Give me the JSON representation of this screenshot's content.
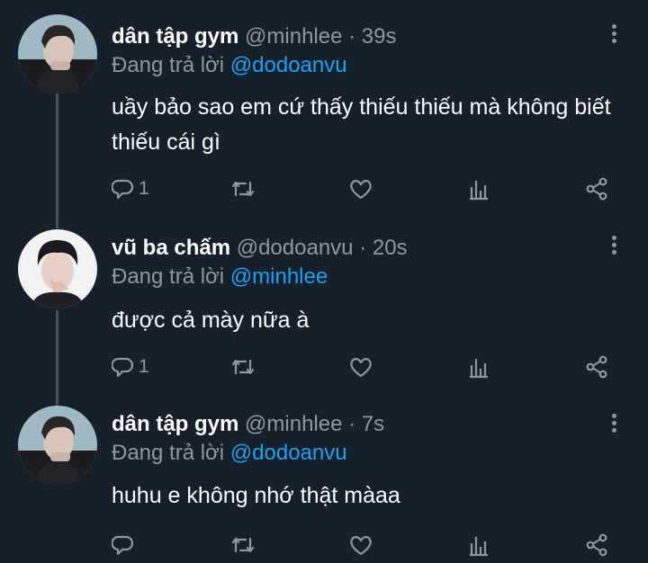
{
  "tweets": [
    {
      "name": "dân tập gym",
      "handle": "@minhlee",
      "dot": "·",
      "time": "39s",
      "reply_prefix": "Đang trả lời",
      "reply_to": "@dodoanvu",
      "text": "uầy bảo sao em cứ thấy thiếu thiếu mà không biết  thiếu cái gì",
      "reply_count": "1"
    },
    {
      "name": "vũ ba chấm",
      "handle": "@dodoanvu",
      "dot": "·",
      "time": "20s",
      "reply_prefix": "Đang trả lời",
      "reply_to": "@minhlee",
      "text": "được cả mày nữa à",
      "reply_count": "1"
    },
    {
      "name": "dân tập gym",
      "handle": "@minhlee",
      "dot": "·",
      "time": "7s",
      "reply_prefix": "Đang trả lời",
      "reply_to": "@dodoanvu",
      "text": "huhu e không nhớ thật màaa",
      "reply_count": ""
    }
  ],
  "colors": {
    "background": "#15202b",
    "secondary_text": "#8899a6",
    "mention": "#1da1f2",
    "thread_line": "#3d5466"
  },
  "icons": [
    "reply-icon",
    "retweet-icon",
    "like-icon",
    "stats-icon",
    "share-icon",
    "more-icon"
  ]
}
